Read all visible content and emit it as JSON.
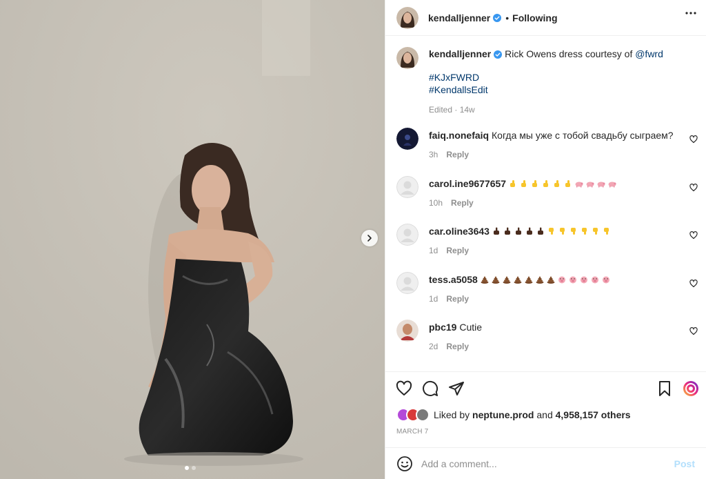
{
  "post": {
    "author": "kendalljenner",
    "follow_status": "Following",
    "caption_text": "Rick Owens dress courtesy of",
    "caption_mention": "@fwrd",
    "hashtags": [
      "#KJxFWRD",
      "#KendallsEdit"
    ],
    "caption_meta": "Edited · 14w"
  },
  "comments": [
    {
      "user": "faiq.nonefaiq",
      "text": "Когда мы уже с тобой свадьбу сыграем?",
      "time": "3h",
      "reply_label": "Reply",
      "avatar_color": "#1a1f3a"
    },
    {
      "user": "carol.ine9677657",
      "text": "",
      "emoji_row": [
        "thumb",
        "thumb",
        "thumb",
        "thumb",
        "thumb",
        "thumb",
        "pig",
        "pig",
        "pig",
        "pig"
      ],
      "time": "10h",
      "reply_label": "Reply",
      "avatar_color": "#dbdbdb"
    },
    {
      "user": "car.oline3643",
      "text": "",
      "emoji_row": [
        "finger",
        "finger",
        "finger",
        "finger",
        "finger",
        "thumbdown",
        "thumbdown",
        "thumbdown",
        "thumbdown",
        "thumbdown",
        "thumbdown"
      ],
      "time": "1d",
      "reply_label": "Reply",
      "avatar_color": "#dbdbdb"
    },
    {
      "user": "tess.a5058",
      "text": "",
      "emoji_row": [
        "poop",
        "poop",
        "poop",
        "poop",
        "poop",
        "poop",
        "poop",
        "pigface",
        "pigface",
        "pigface",
        "pigface",
        "pigface"
      ],
      "time": "1d",
      "reply_label": "Reply",
      "avatar_color": "#dbdbdb"
    },
    {
      "user": "pbc19",
      "text": "Cutie",
      "time": "2d",
      "reply_label": "Reply",
      "avatar_color": "#c48a6a"
    }
  ],
  "likes": {
    "prefix": "Liked by",
    "user": "neptune.prod",
    "middle": "and",
    "count": "4,958,157 others"
  },
  "date": "MARCH 7",
  "add_comment": {
    "placeholder": "Add a comment...",
    "post_label": "Post"
  },
  "carousel": {
    "index": 1,
    "total": 2
  },
  "colors": {
    "link": "#00376b",
    "verified": "#3897f0",
    "muted": "#8e8e8e",
    "post_disabled": "#b2dffc"
  }
}
